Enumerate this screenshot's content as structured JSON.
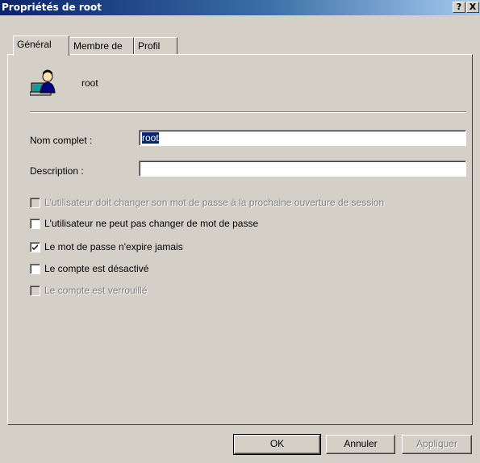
{
  "window": {
    "title": "Propriétés de root",
    "help_label": "?",
    "close_label": "X"
  },
  "tabs": [
    {
      "label": "Général",
      "active": true
    },
    {
      "label": "Membre de",
      "active": false
    },
    {
      "label": "Profil",
      "active": false
    }
  ],
  "user": {
    "icon": "user-computer-icon",
    "name": "root"
  },
  "fields": {
    "full_name_label": "Nom complet :",
    "full_name_value": "root",
    "description_label": "Description :",
    "description_value": ""
  },
  "checkboxes": [
    {
      "label": "L'utilisateur doit changer son mot de passe à la prochaine ouverture de session",
      "checked": false,
      "enabled": false
    },
    {
      "label": "L'utilisateur ne peut pas changer de mot de passe",
      "checked": false,
      "enabled": true
    },
    {
      "label": "Le mot de passe n'expire jamais",
      "checked": true,
      "enabled": true
    },
    {
      "label": "Le compte est désactivé",
      "checked": false,
      "enabled": true
    },
    {
      "label": "Le compte est verrouillé",
      "checked": false,
      "enabled": false
    }
  ],
  "buttons": {
    "ok": "OK",
    "cancel": "Annuler",
    "apply": "Appliquer"
  },
  "colors": {
    "titlebar_start": "#0a246a",
    "titlebar_end": "#a6caf0",
    "face": "#d4d0c8",
    "selection": "#0a246a"
  }
}
